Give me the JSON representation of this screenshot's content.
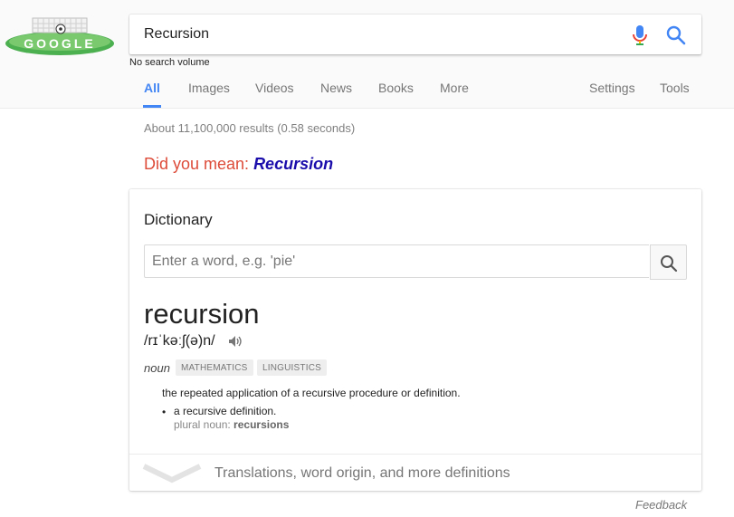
{
  "search": {
    "query": "Recursion",
    "volume_note": "No search volume"
  },
  "tabs": [
    {
      "label": "All",
      "active": true
    },
    {
      "label": "Images"
    },
    {
      "label": "Videos"
    },
    {
      "label": "News"
    },
    {
      "label": "Books"
    },
    {
      "label": "More"
    }
  ],
  "tools": {
    "settings": "Settings",
    "tools": "Tools"
  },
  "results": {
    "stats": "About 11,100,000 results (0.58 seconds)",
    "did_you_mean_prefix": "Did you mean: ",
    "did_you_mean_link": "Recursion"
  },
  "dictionary": {
    "title": "Dictionary",
    "input_placeholder": "Enter a word, e.g. 'pie'",
    "word": "recursion",
    "phonetic": "/rɪˈkəːʃ(ə)n/",
    "part_of_speech": "noun",
    "tags": [
      "MATHEMATICS",
      "LINGUISTICS"
    ],
    "definition": "the repeated application of a recursive procedure or definition.",
    "bullet": "•",
    "sub_definition": "a recursive definition.",
    "plural_prefix": "plural noun: ",
    "plural_word": "recursions",
    "more": "Translations, word origin, and more definitions"
  },
  "feedback": "Feedback",
  "logo": {
    "text": "GOOGLE"
  },
  "colors": {
    "accent": "#4285f4",
    "did_you_mean": "#dd4b39",
    "link": "#1a0dab",
    "logo_field": "#4caf50"
  }
}
